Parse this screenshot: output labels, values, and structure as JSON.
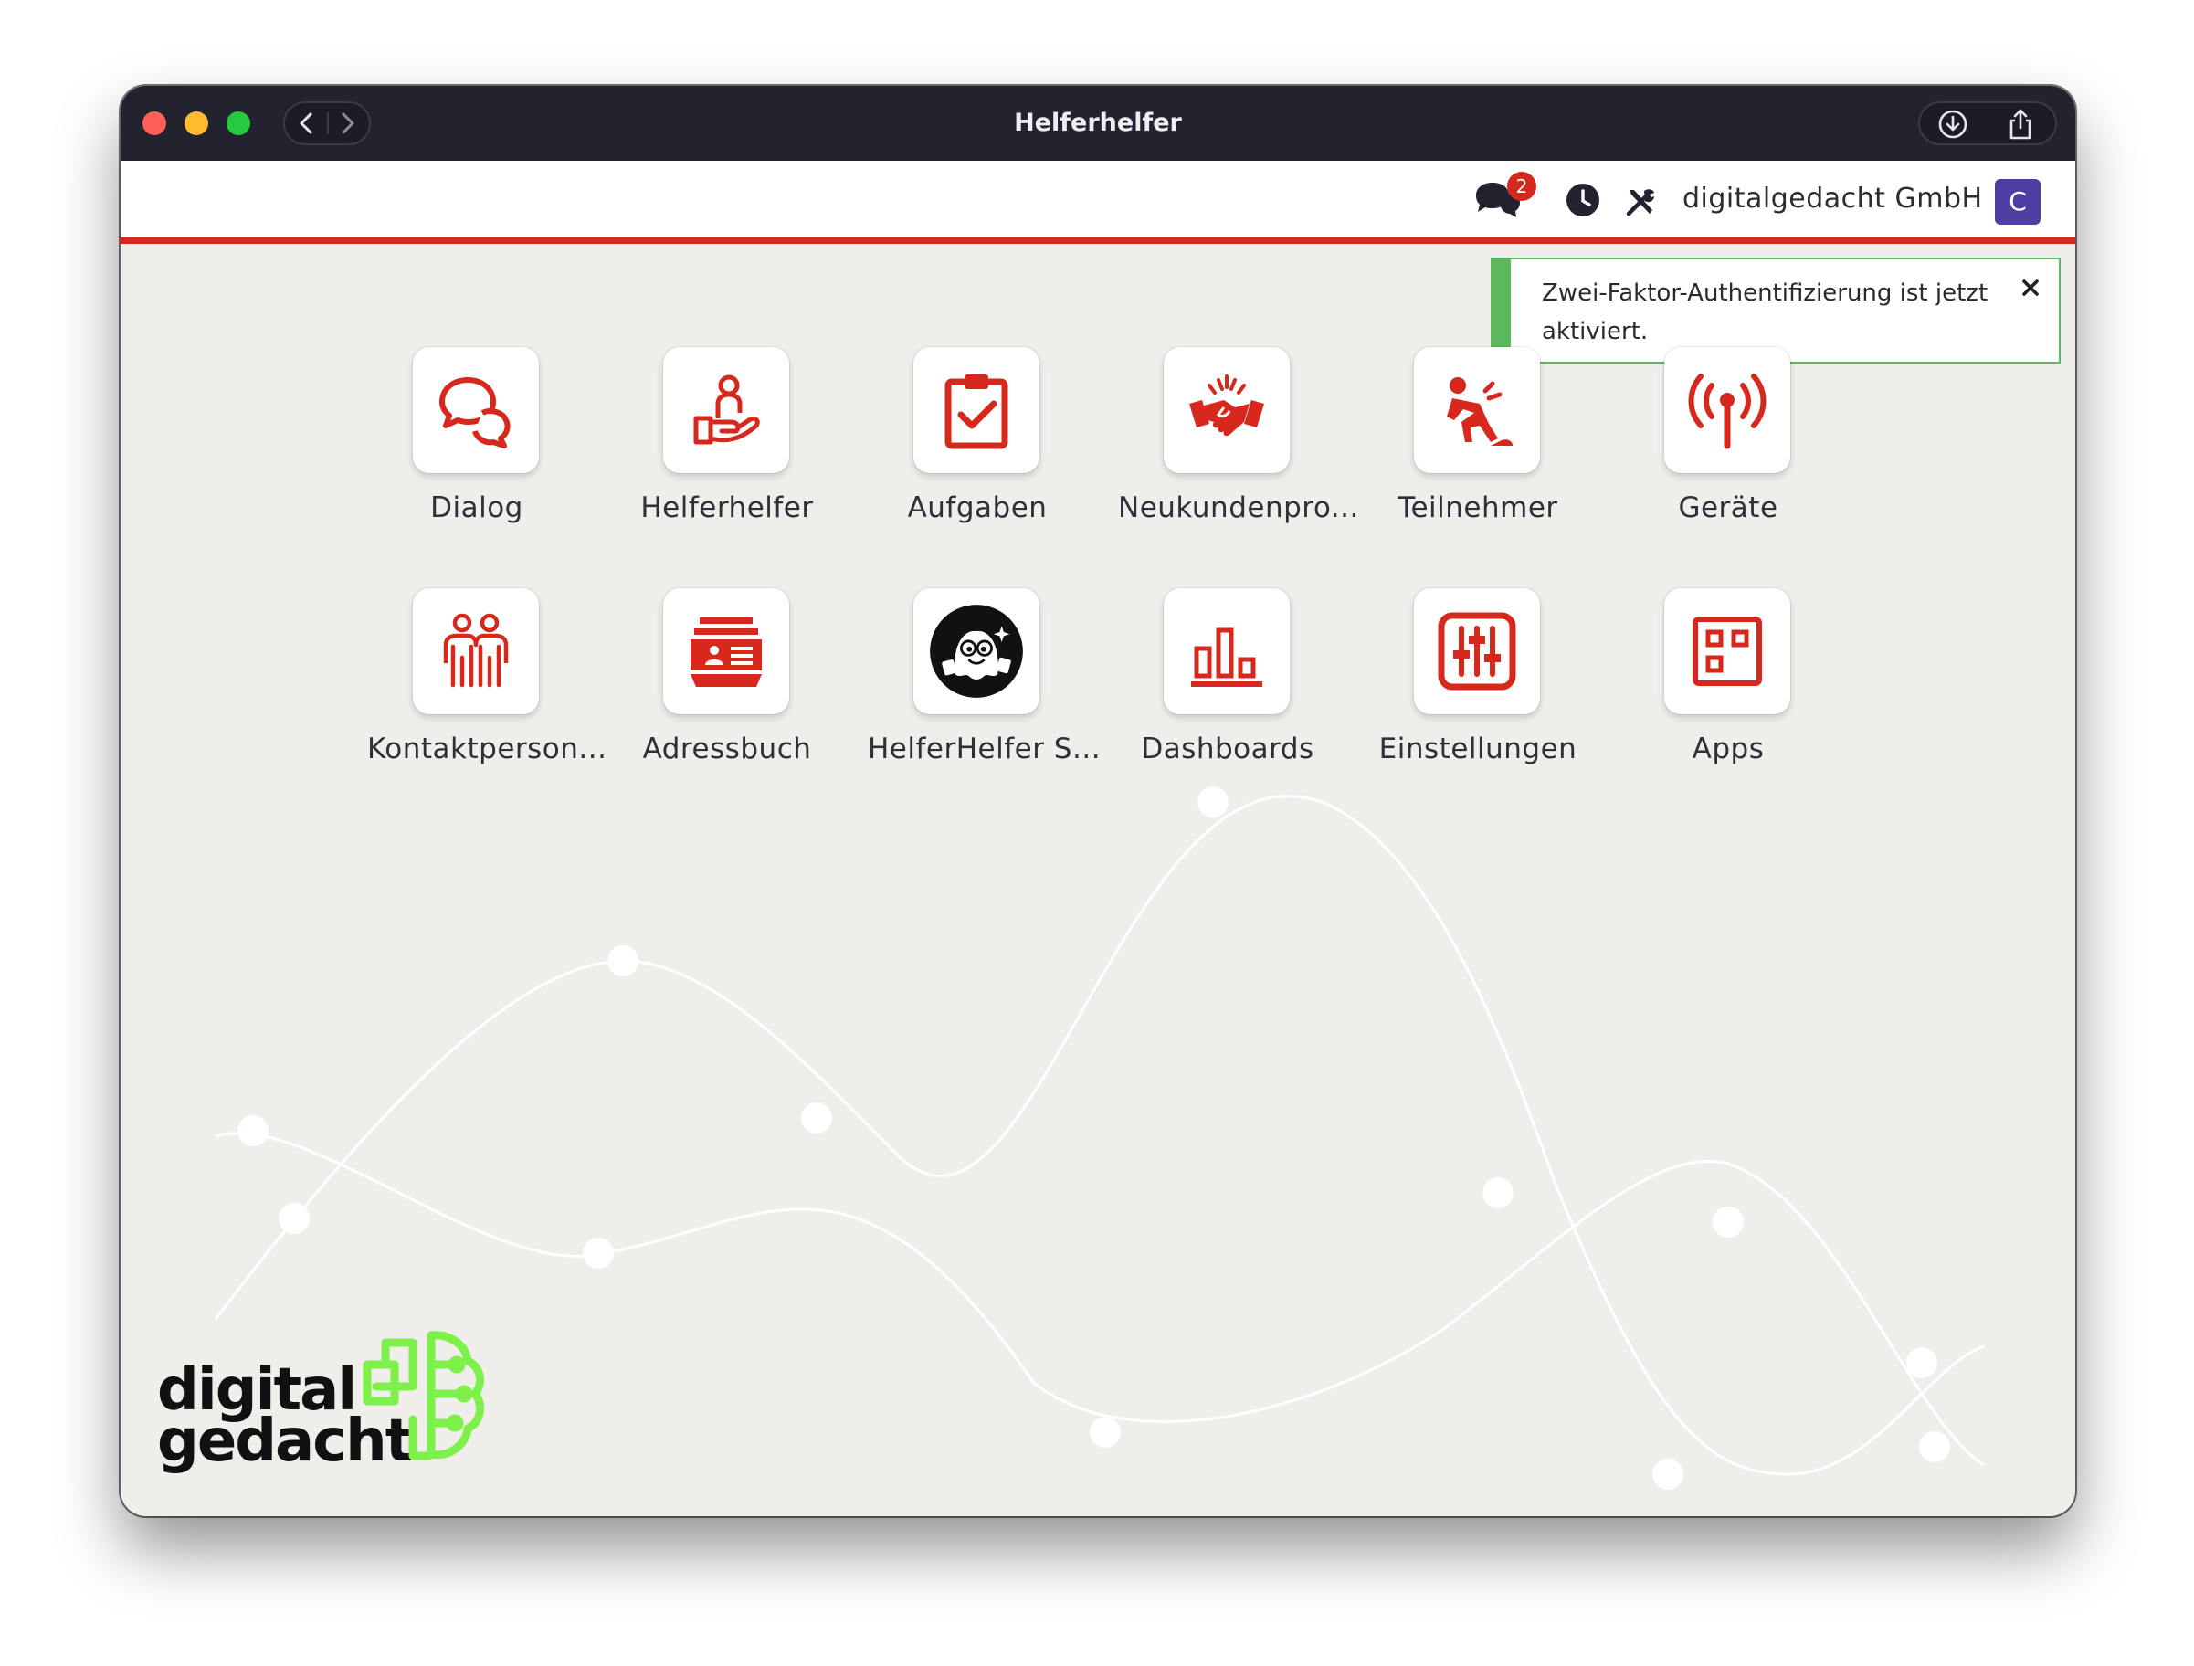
{
  "window": {
    "title": "Helferhelfer"
  },
  "topbar": {
    "chat_badge": "2",
    "company": "digitalgedacht GmbH",
    "avatar_letter": "C"
  },
  "toast": {
    "message": "Zwei-Faktor-Authentifizierung ist jetzt aktiviert."
  },
  "apps": [
    {
      "label": "Dialog",
      "icon": "chat-bubbles-icon"
    },
    {
      "label": "Helferhelfer",
      "icon": "helping-hand-icon"
    },
    {
      "label": "Aufgaben",
      "icon": "clipboard-check-icon"
    },
    {
      "label": "Neukundenpro...",
      "icon": "handshake-icon"
    },
    {
      "label": "Teilnehmer",
      "icon": "falling-person-icon"
    },
    {
      "label": "Geräte",
      "icon": "antenna-icon"
    },
    {
      "label": "Kontaktperson...",
      "icon": "people-icon"
    },
    {
      "label": "Adressbuch",
      "icon": "address-card-icon"
    },
    {
      "label": "HelferHelfer S...",
      "icon": "mascot-icon"
    },
    {
      "label": "Dashboards",
      "icon": "bar-chart-icon"
    },
    {
      "label": "Einstellungen",
      "icon": "sliders-icon"
    },
    {
      "label": "Apps",
      "icon": "app-grid-icon"
    }
  ],
  "logo": {
    "line1": "digital",
    "line2": "gedacht"
  },
  "colors": {
    "accent": "#d6281c",
    "success": "#5cb85c",
    "avatar": "#4c3fa1",
    "logo_green": "#7df04a"
  }
}
